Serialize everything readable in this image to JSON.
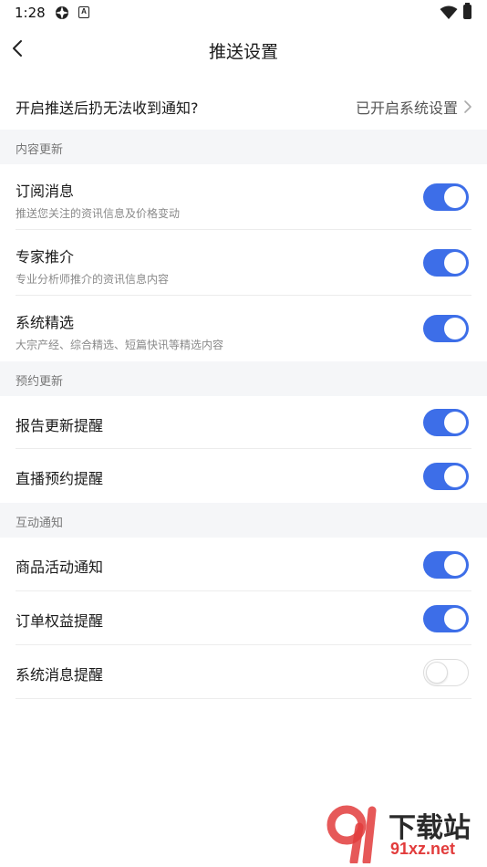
{
  "status_bar": {
    "time": "1:28",
    "a_icon_letter": "A"
  },
  "header": {
    "title": "推送设置"
  },
  "notice": {
    "text": "开启推送后扔无法收到通知?",
    "link": "已开启系统设置"
  },
  "sections": {
    "content": {
      "title": "内容更新",
      "items": [
        {
          "title": "订阅消息",
          "subtitle": "推送您关注的资讯信息及价格变动",
          "enabled": true
        },
        {
          "title": "专家推介",
          "subtitle": "专业分析师推介的资讯信息内容",
          "enabled": true
        },
        {
          "title": "系统精选",
          "subtitle": "大宗产经、综合精选、短篇快讯等精选内容",
          "enabled": true
        }
      ]
    },
    "booking": {
      "title": "预约更新",
      "items": [
        {
          "title": "报告更新提醒",
          "enabled": true
        },
        {
          "title": "直播预约提醒",
          "enabled": true
        }
      ]
    },
    "interaction": {
      "title": "互动通知",
      "items": [
        {
          "title": "商品活动通知",
          "enabled": true
        },
        {
          "title": "订单权益提醒",
          "enabled": true
        },
        {
          "title": "系统消息提醒",
          "enabled": false
        }
      ]
    }
  },
  "watermark": {
    "cn": "下载站",
    "en": "91xz.net"
  },
  "colors": {
    "toggle_on": "#3d6ee8",
    "section_bg": "#f5f6f8",
    "watermark_red": "#e23c3c"
  }
}
